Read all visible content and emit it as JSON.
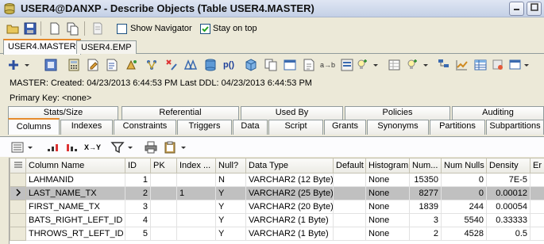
{
  "window": {
    "title": "USER4@DANXP - Describe Objects (Table USER4.MASTER)"
  },
  "toolbar_top": {
    "show_navigator_label": "Show Navigator",
    "stay_on_top_label": "Stay on top",
    "show_navigator_checked": false,
    "stay_on_top_checked": true
  },
  "doc_tabs": [
    "USER4.MASTER",
    "USER4.EMP"
  ],
  "info": {
    "line1": "MASTER:   Created: 04/23/2013 6:44:53 PM    Last DDL: 04/23/2013 6:44:53 PM",
    "line2": "Primary Key:  <none>"
  },
  "action_toolbar": {
    "p_label": "p()",
    "ab_label": "a→b"
  },
  "tabs_row1": [
    "Stats/Size",
    "Referential",
    "Used By",
    "Policies",
    "Auditing"
  ],
  "tabs_row2": [
    "Columns",
    "Indexes",
    "Constraints",
    "Triggers",
    "Data",
    "Script",
    "Grants",
    "Synonyms",
    "Partitions",
    "Subpartitions"
  ],
  "grid_toolbar": {
    "xy_label": "X→Y"
  },
  "table": {
    "headers": [
      "Column Name",
      "ID",
      "PK",
      "Index ...",
      "Null?",
      "Data Type",
      "Default",
      "Histogram",
      "Num...",
      "Num Nulls",
      "Density",
      "Er"
    ],
    "rows": [
      [
        "LAHMANID",
        "1",
        "",
        "",
        "N",
        "VARCHAR2 (12 Byte)",
        "",
        "None",
        "15350",
        "0",
        "7E-5",
        ""
      ],
      [
        "LAST_NAME_TX",
        "2",
        "",
        "1",
        "Y",
        "VARCHAR2 (25 Byte)",
        "",
        "None",
        "8277",
        "0",
        "0.00012",
        ""
      ],
      [
        "FIRST_NAME_TX",
        "3",
        "",
        "",
        "Y",
        "VARCHAR2 (20 Byte)",
        "",
        "None",
        "1839",
        "244",
        "0.00054",
        ""
      ],
      [
        "BATS_RIGHT_LEFT_ID",
        "4",
        "",
        "",
        "Y",
        "VARCHAR2 (1 Byte)",
        "",
        "None",
        "3",
        "5540",
        "0.33333",
        ""
      ],
      [
        "THROWS_RT_LEFT_ID",
        "5",
        "",
        "",
        "Y",
        "VARCHAR2 (1 Byte)",
        "",
        "None",
        "2",
        "4528",
        "0.5",
        ""
      ]
    ],
    "selected_row": 1
  }
}
